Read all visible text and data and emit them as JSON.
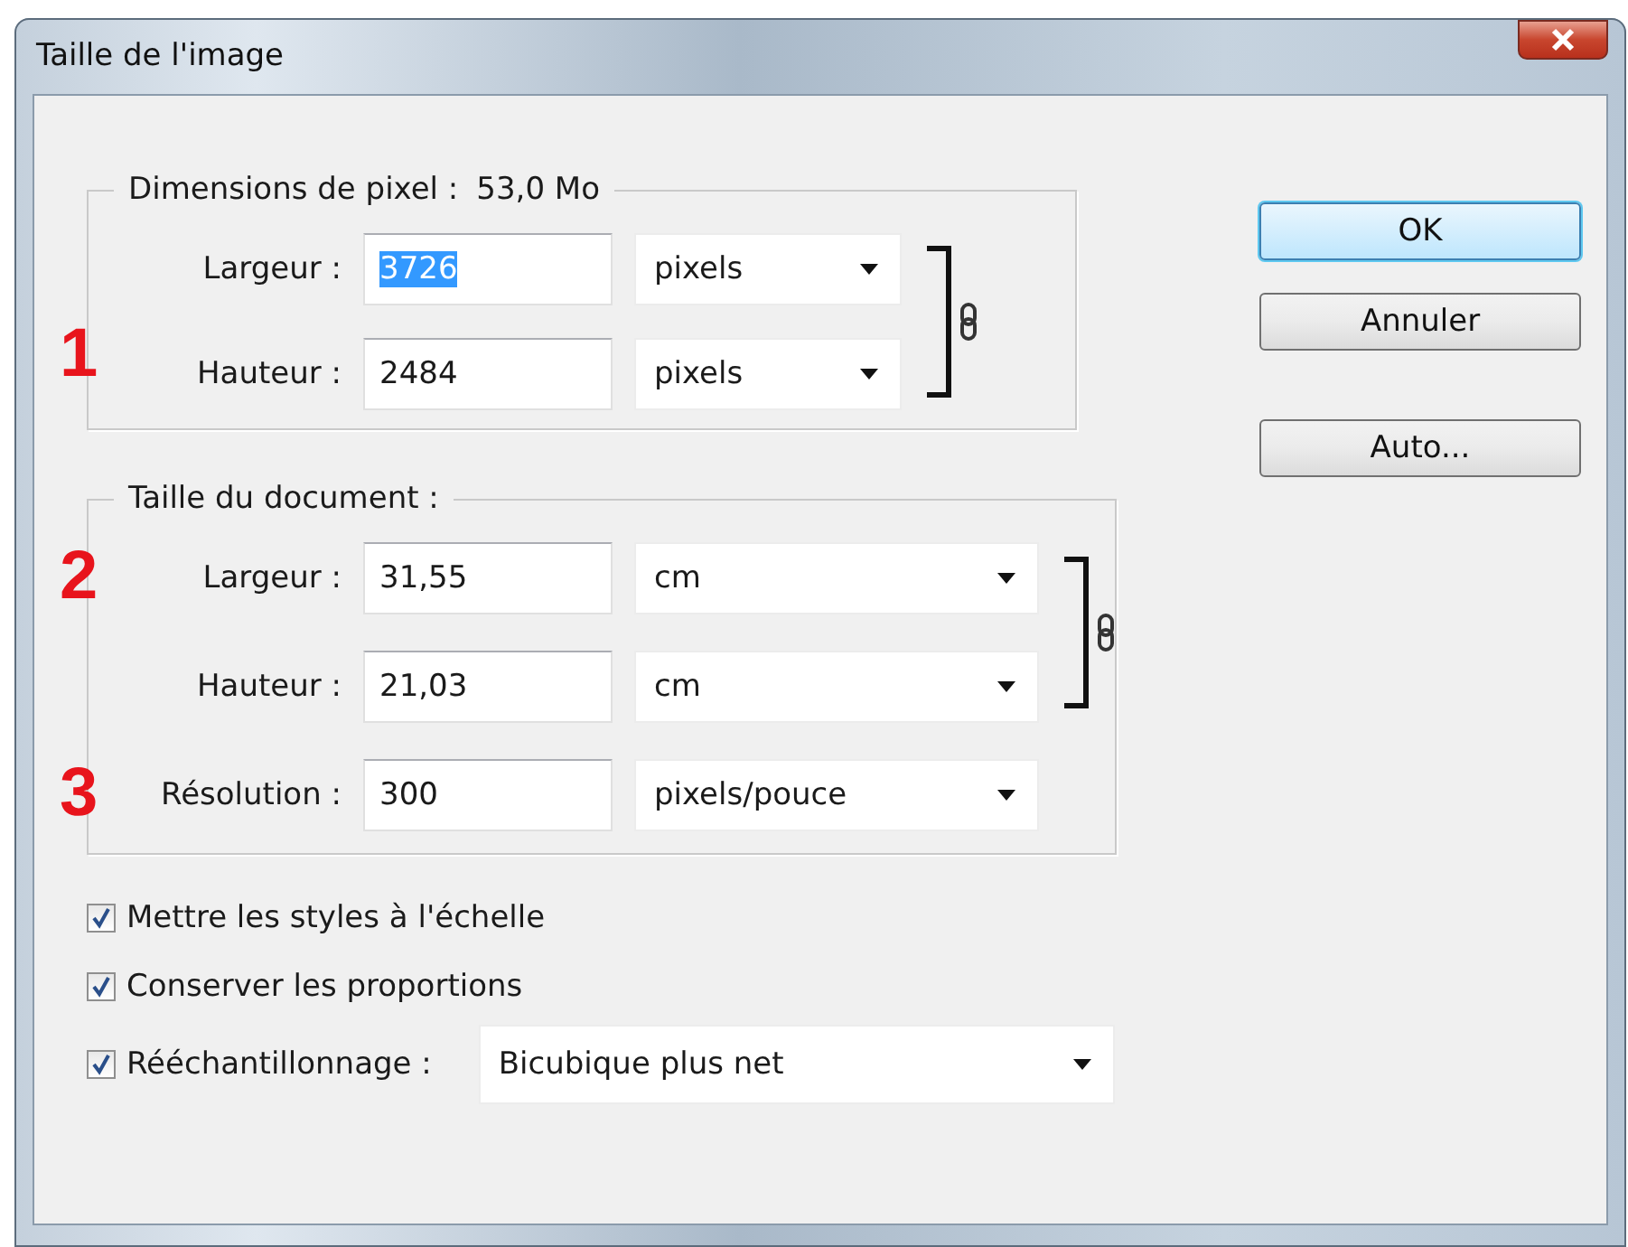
{
  "window": {
    "title": "Taille de l'image"
  },
  "groups": [
    {
      "title": "Dimensions de pixel :",
      "value": "53,0 Mo",
      "marker": "1",
      "linked": true,
      "rows": [
        {
          "label": "Largeur :",
          "value": "3726",
          "text_selected": true,
          "unit": "pixels"
        },
        {
          "label": "Hauteur :",
          "value": "2484",
          "text_selected": false,
          "unit": "pixels"
        }
      ]
    },
    {
      "title": "Taille du document :",
      "linked": true,
      "rows": [
        {
          "label": "Largeur :",
          "value": "31,55",
          "text_selected": false,
          "unit": "cm",
          "marker": "2"
        },
        {
          "label": "Hauteur :",
          "value": "21,03",
          "text_selected": false,
          "unit": "cm"
        },
        {
          "label": "Résolution :",
          "value": "300",
          "text_selected": false,
          "unit": "pixels/pouce",
          "marker": "3"
        }
      ]
    }
  ],
  "options": [
    {
      "kind": "checkbox",
      "label": "Mettre les styles à l'échelle",
      "checked": true
    },
    {
      "kind": "checkbox",
      "label": "Conserver les proportions",
      "checked": true
    },
    {
      "kind": "checkbox-select",
      "label": "Rééchantillonnage :",
      "checked": true,
      "select": "Bicubique plus net"
    }
  ],
  "buttons": [
    {
      "label": "OK",
      "default": true
    },
    {
      "label": "Annuler",
      "default": false
    },
    {
      "label": "Auto...",
      "default": false
    }
  ]
}
